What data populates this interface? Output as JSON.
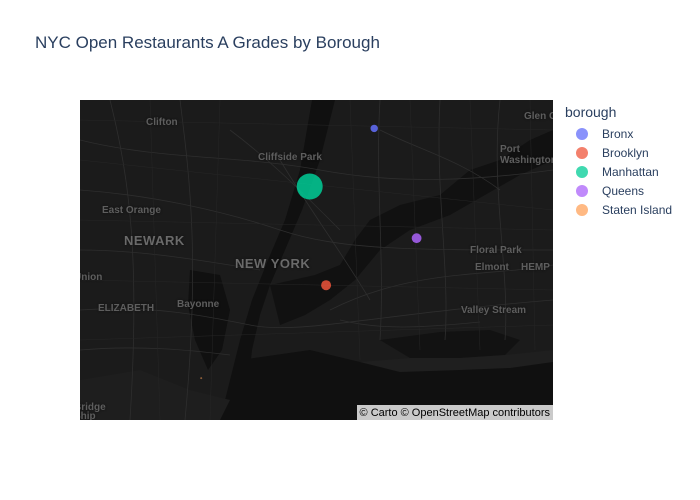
{
  "title": "NYC Open Restaurants A Grades by Borough",
  "map": {
    "style": "carto-darkmatter",
    "attribution": "© Carto © OpenStreetMap contributors",
    "place_labels": [
      "Clifton",
      "Cliffside Park",
      "East Orange",
      "NEWARK",
      "NEW YORK",
      "ELIZABETH",
      "Bayonne",
      "Union",
      "Port Washington",
      "Floral Park",
      "Elmont",
      "HEMP",
      "Valley Stream",
      "Glen C",
      "Bridge",
      "Ship"
    ]
  },
  "legend": {
    "title": "borough",
    "items": [
      {
        "label": "Bronx",
        "color": "#636efa"
      },
      {
        "label": "Brooklyn",
        "color": "#EF553B"
      },
      {
        "label": "Manhattan",
        "color": "#00cc96"
      },
      {
        "label": "Queens",
        "color": "#ab63fa"
      },
      {
        "label": "Staten Island",
        "color": "#FFA15A"
      }
    ]
  },
  "chart_data": {
    "type": "scatter",
    "title": "NYC Open Restaurants A Grades by Borough",
    "legend_title": "borough",
    "legend_position": "right",
    "series": [
      {
        "name": "Bronx",
        "lat": 40.8448,
        "lon": -73.8648,
        "relative_size": 0.08
      },
      {
        "name": "Brooklyn",
        "lat": 40.6782,
        "lon": -73.9442,
        "relative_size": 0.15
      },
      {
        "name": "Manhattan",
        "lat": 40.7831,
        "lon": -73.9712,
        "relative_size": 1.0
      },
      {
        "name": "Queens",
        "lat": 40.7282,
        "lon": -73.7949,
        "relative_size": 0.14
      },
      {
        "name": "Staten Island",
        "lat": 40.5795,
        "lon": -74.1502,
        "relative_size": 0.0
      }
    ]
  }
}
